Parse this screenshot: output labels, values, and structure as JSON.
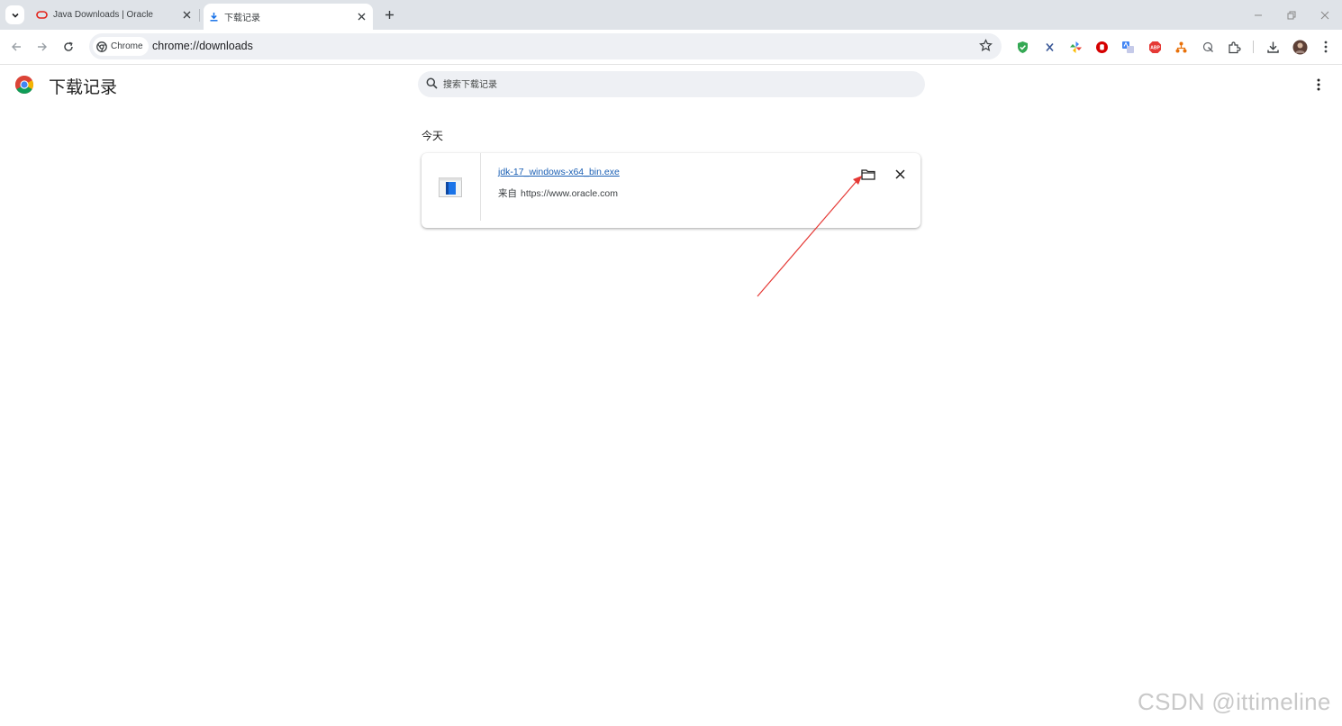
{
  "tabs": [
    {
      "title": "Java Downloads | Oracle",
      "active": false,
      "favicon": "oracle-logo-icon"
    },
    {
      "title": "下载记录",
      "active": true,
      "favicon": "download-icon"
    }
  ],
  "omnibox": {
    "chip_label": "Chrome",
    "url": "chrome://downloads"
  },
  "extensions": [
    "shield-check-icon",
    "x-extension-icon",
    "pinwheel-icon",
    "red-stop-icon",
    "translate-icon",
    "abp-icon",
    "network-icon",
    "cursor-icon",
    "puzzle-icon"
  ],
  "page": {
    "title": "下载记录",
    "search_placeholder": "搜索下载记录",
    "section_date": "今天"
  },
  "downloads": [
    {
      "filename": "jdk-17_windows-x64_bin.exe",
      "source_prefix": "来自",
      "source_url": "https://www.oracle.com"
    }
  ],
  "watermark": "CSDN @ittimeline",
  "colors": {
    "link": "#1a5fb4",
    "annotation_arrow": "#e53935",
    "tab_strip": "#dfe3e8"
  }
}
